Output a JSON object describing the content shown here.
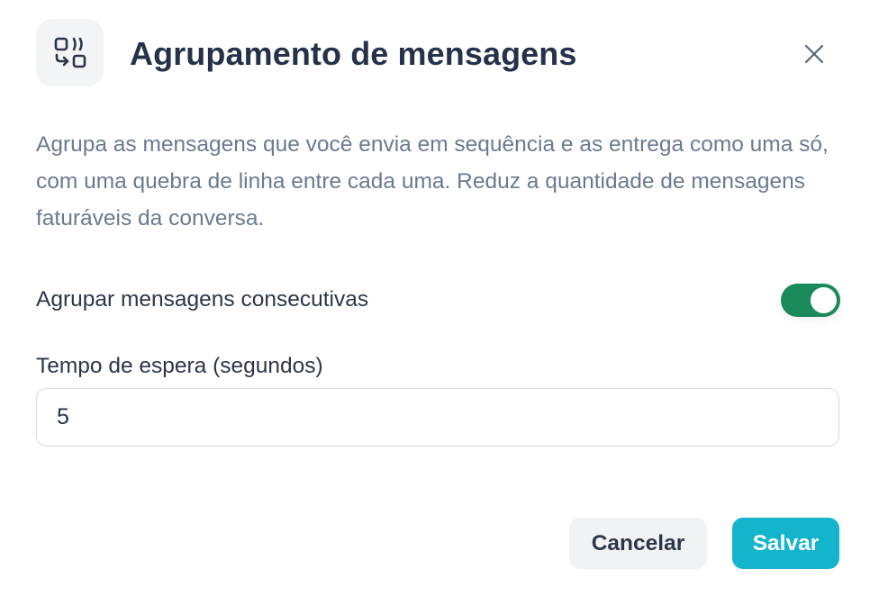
{
  "dialog": {
    "title": "Agrupamento de mensagens",
    "header_icon": "message-grouping-icon",
    "close_icon": "close-icon",
    "description": "Agrupa as mensagens que você envia em sequência e as entrega como uma só, com uma quebra de linha entre cada uma. Reduz a quantidade de mensagens faturáveis da conversa."
  },
  "settings": {
    "toggle_label": "Agrupar mensagens consecutivas",
    "toggle_on": true,
    "wait_label": "Tempo de espera (segundos)",
    "wait_value": "5"
  },
  "actions": {
    "cancel_label": "Cancelar",
    "save_label": "Salvar"
  },
  "colors": {
    "toggle_on": "#1b8a5a",
    "save_button": "#14b4cc",
    "title_text": "#26324a",
    "description_text": "#6b7a8f"
  }
}
